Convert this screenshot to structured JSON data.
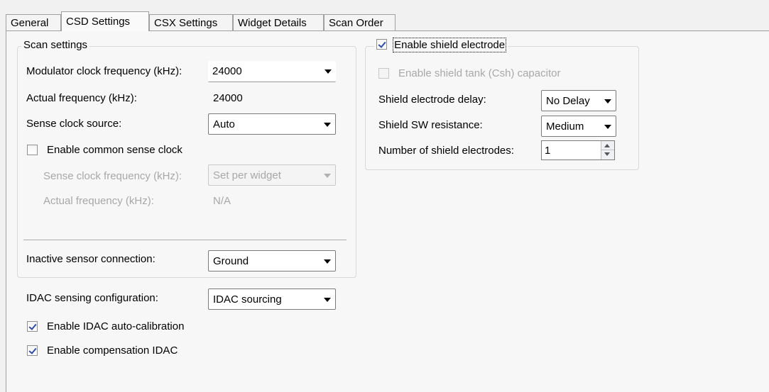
{
  "tabs": [
    "General",
    "CSD Settings",
    "CSX Settings",
    "Widget Details",
    "Scan Order"
  ],
  "active_tab": "CSD Settings",
  "scan_settings": {
    "legend": "Scan settings",
    "modulator_label": "Modulator clock frequency (kHz):",
    "modulator_value": "24000",
    "actual_freq_label": "Actual frequency (kHz):",
    "actual_freq_value": "24000",
    "sense_source_label": "Sense clock source:",
    "sense_source_value": "Auto",
    "common_sense_label": "Enable common sense clock",
    "common_sense_checked": false,
    "sense_freq_label": "Sense clock frequency (kHz):",
    "sense_freq_value": "Set per widget",
    "actual_freq2_label": "Actual frequency (kHz):",
    "actual_freq2_value": "N/A",
    "inactive_label": "Inactive sensor connection:",
    "inactive_value": "Ground"
  },
  "idac": {
    "config_label": "IDAC sensing configuration:",
    "config_value": "IDAC sourcing",
    "auto_cal_label": "Enable IDAC auto-calibration",
    "auto_cal_checked": true,
    "compensation_label": "Enable compensation IDAC",
    "compensation_checked": true
  },
  "shield": {
    "enable_label": "Enable shield electrode",
    "enable_checked": true,
    "tank_label": "Enable shield tank (Csh) capacitor",
    "tank_checked": false,
    "delay_label": "Shield electrode delay:",
    "delay_value": "No Delay",
    "sw_label": "Shield SW resistance:",
    "sw_value": "Medium",
    "count_label": "Number of shield electrodes:",
    "count_value": "1"
  },
  "colors": {
    "background": "#f1f1f1",
    "panel": "#f7f7f7",
    "disabled_text": "#a8a8a8",
    "checkmark": "#2a4bb0"
  }
}
